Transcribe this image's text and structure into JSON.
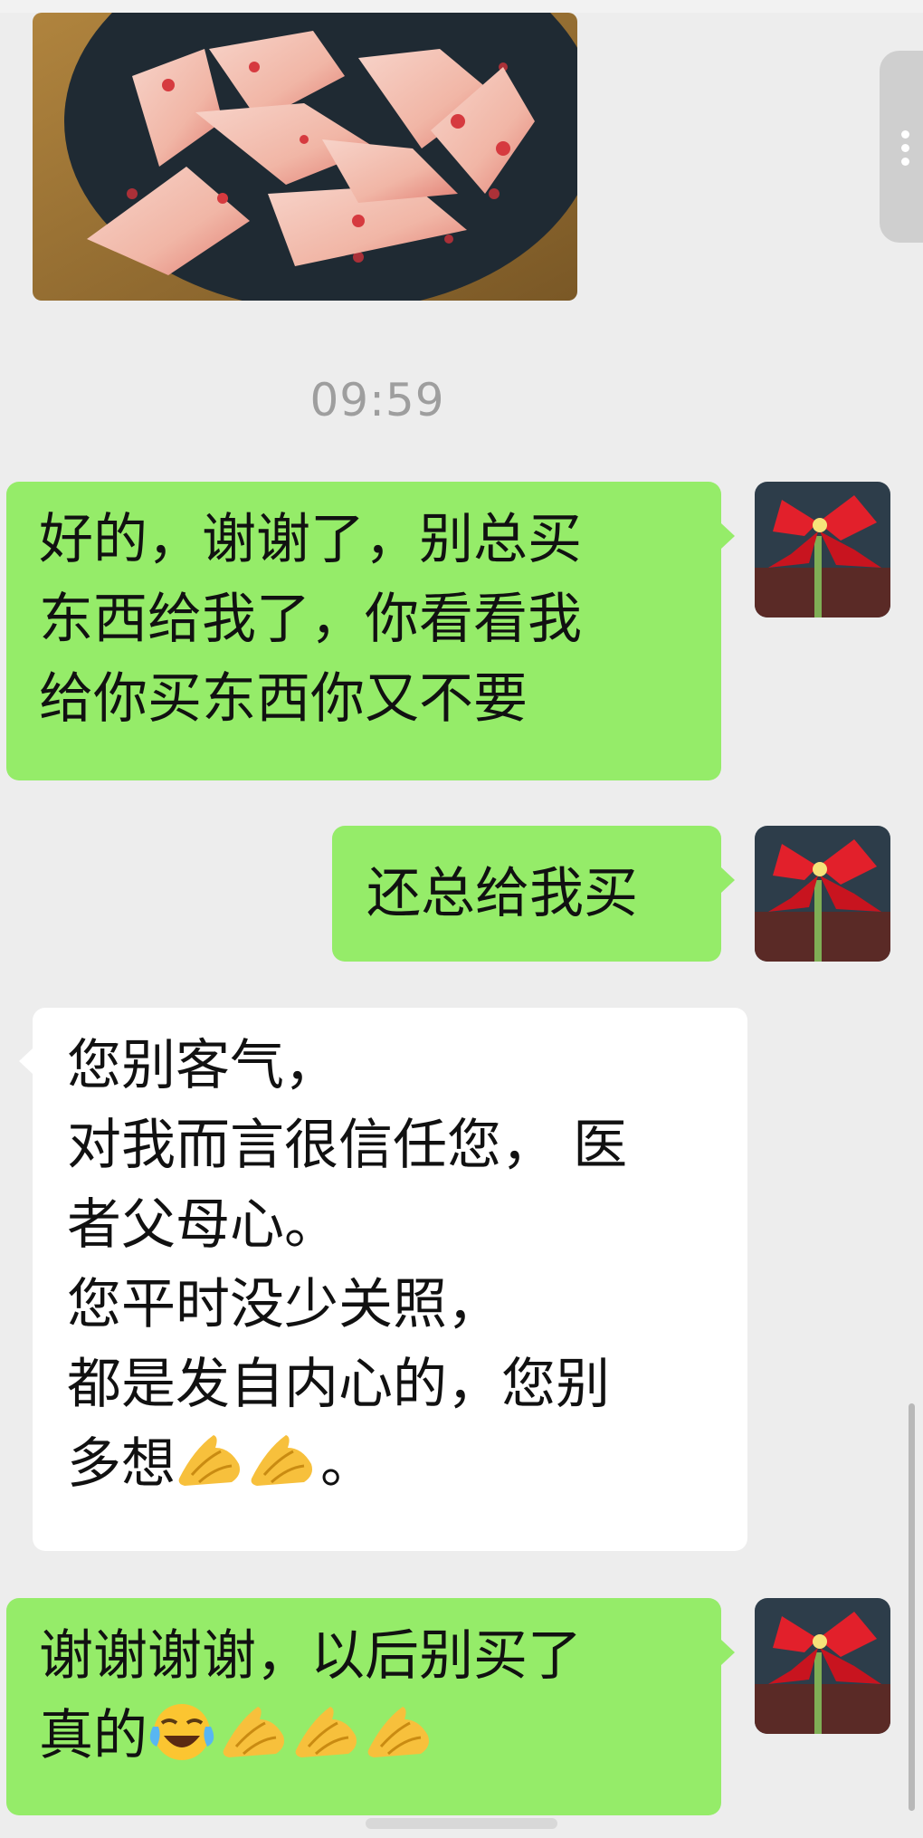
{
  "chat": {
    "timestamp": "09:59",
    "messages": [
      {
        "id": "m1",
        "side": "sent",
        "lines": [
          "好的，谢谢了，别总买",
          "东西给我了，你看看我",
          "给你买东西你又不要"
        ]
      },
      {
        "id": "m2",
        "side": "sent",
        "lines": [
          "还总给我买"
        ]
      },
      {
        "id": "m3",
        "side": "received",
        "lines": [
          "您别客气，",
          "对我而言很信任您， 医",
          "者父母心。",
          "您平时没少关照，",
          "都是发自内心的，您别",
          "多想"
        ],
        "trailing_emojis": [
          "folded-hands",
          "folded-hands"
        ],
        "trailing_text": "。"
      },
      {
        "id": "m4",
        "side": "sent",
        "lines": [
          "谢谢谢谢，以后别买了",
          "真的"
        ],
        "trailing_emojis": [
          "crying-laughing",
          "folded-hands",
          "folded-hands",
          "folded-hands"
        ]
      }
    ]
  },
  "colors": {
    "sent_bubble": "#95ec69",
    "received_bubble": "#ffffff",
    "background": "#ededed",
    "timestamp_text": "#9e9e9e"
  },
  "icons": {
    "avatar": "red-amaryllis-flower-avatar",
    "image": "sliced-peaches-on-plate-photo",
    "side_handle": "vertical-ellipsis-icon"
  }
}
